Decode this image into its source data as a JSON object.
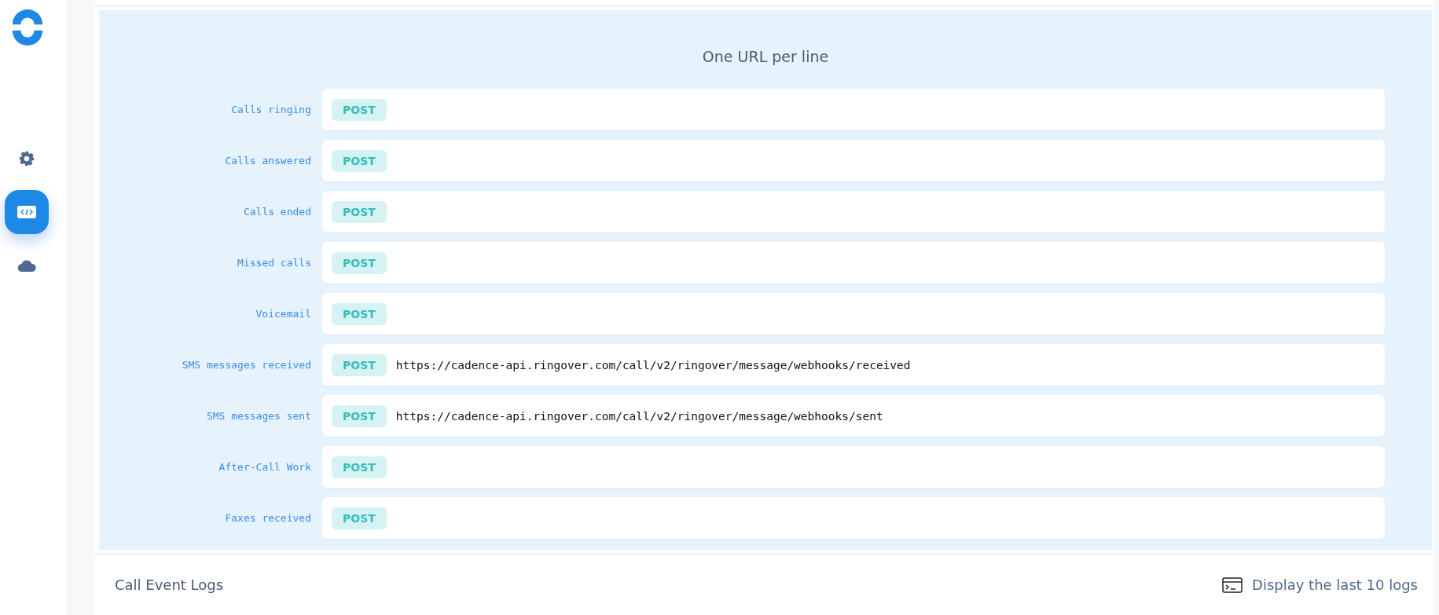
{
  "sidebar": {
    "items": [
      {
        "kind": "settings",
        "selected": false
      },
      {
        "kind": "code",
        "selected": true
      },
      {
        "kind": "cloud",
        "selected": false
      }
    ]
  },
  "webhooks": {
    "title": "One URL per line",
    "rows": [
      {
        "label": "Calls ringing",
        "method": "POST"
      },
      {
        "label": "Calls answered",
        "method": "POST"
      },
      {
        "label": "Calls ended",
        "method": "POST"
      },
      {
        "label": "Missed calls",
        "method": "POST"
      },
      {
        "label": "Voicemail",
        "method": "POST"
      },
      {
        "label": "SMS messages received",
        "method": "POST",
        "value": "https://cadence-api.ringover.com/call/v2/ringover/message/webhooks/received"
      },
      {
        "label": "SMS messages sent",
        "method": "POST",
        "value": "https://cadence-api.ringover.com/call/v2/ringover/message/webhooks/sent"
      },
      {
        "label": "After-Call Work",
        "method": "POST"
      },
      {
        "label": "Faxes received",
        "method": "POST"
      }
    ]
  },
  "logs": {
    "title": "Call Event Logs",
    "link": "Display the last 10 logs"
  }
}
